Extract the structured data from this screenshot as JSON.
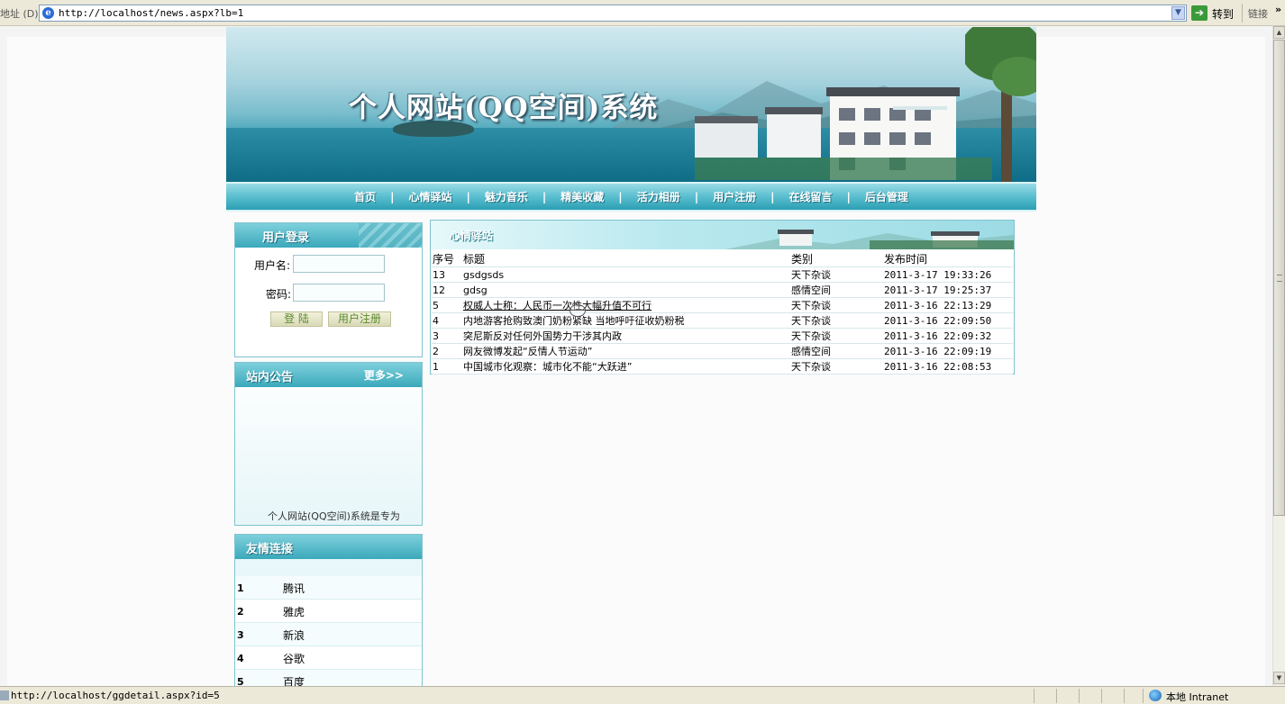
{
  "browser": {
    "address_label": "地址 (D)",
    "url": "http://localhost/news.aspx?lb=1",
    "go_label": "转到",
    "links_label": "链接",
    "links_chevron": "»",
    "status_url": "http://localhost/ggdetail.aspx?id=5",
    "status_zone": "本地 Intranet"
  },
  "banner": {
    "title": "个人网站(QQ空间)系统"
  },
  "nav": {
    "items": [
      "首页",
      "心情驿站",
      "魅力音乐",
      "精美收藏",
      "活力相册",
      "用户注册",
      "在线留言",
      "后台管理"
    ],
    "separator": "|"
  },
  "login": {
    "title": "用户登录",
    "username_label": "用户名:",
    "password_label": "密码:",
    "login_button": "登 陆",
    "register_button": "用户注册"
  },
  "notice": {
    "title": "站内公告",
    "more": "更多>>",
    "text": "个人网站(QQ空间)系统是专为"
  },
  "links": {
    "title": "友情连接",
    "items": [
      {
        "num": "1",
        "name": "腾讯"
      },
      {
        "num": "2",
        "name": "雅虎"
      },
      {
        "num": "3",
        "name": "新浪"
      },
      {
        "num": "4",
        "name": "谷歌"
      },
      {
        "num": "5",
        "name": "百度"
      }
    ]
  },
  "news": {
    "title": "心情驿站",
    "headers": [
      "序号",
      "标题",
      "类别",
      "发布时间"
    ],
    "rows": [
      {
        "id": "13",
        "title": "gsdgsds",
        "category": "天下杂谈",
        "time": "2011-3-17 19:33:26"
      },
      {
        "id": "12",
        "title": "gdsg",
        "category": "感情空间",
        "time": "2011-3-17 19:25:37"
      },
      {
        "id": "5",
        "title": "权威人士称：人民币一次性大幅升值不可行",
        "category": "天下杂谈",
        "time": "2011-3-16 22:13:29"
      },
      {
        "id": "4",
        "title": "内地游客抢购致澳门奶粉紧缺 当地呼吁征收奶粉税",
        "category": "天下杂谈",
        "time": "2011-3-16 22:09:50"
      },
      {
        "id": "3",
        "title": "突尼斯反对任何外国势力干涉其内政",
        "category": "天下杂谈",
        "time": "2011-3-16 22:09:32"
      },
      {
        "id": "2",
        "title": "网友微博发起“反情人节运动”",
        "category": "感情空间",
        "time": "2011-3-16 22:09:19"
      },
      {
        "id": "1",
        "title": "中国城市化观察：城市化不能“大跃进”",
        "category": "天下杂谈",
        "time": "2011-3-16 22:08:53"
      }
    ]
  }
}
